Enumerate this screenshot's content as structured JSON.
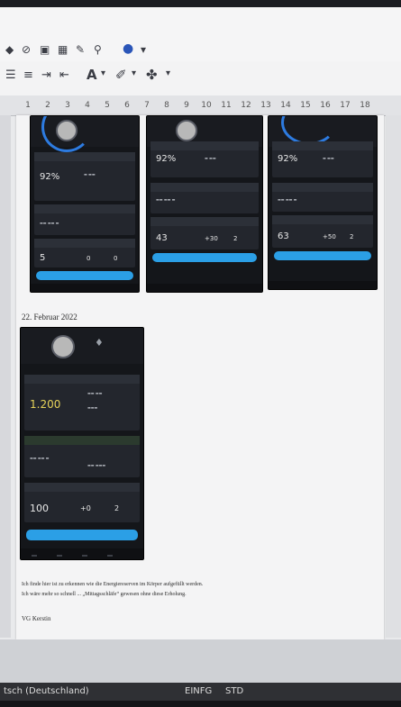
{
  "ruler": {
    "ticks": [
      "1",
      "2",
      "3",
      "4",
      "5",
      "6",
      "7",
      "8",
      "9",
      "10",
      "11",
      "12",
      "13",
      "14",
      "15",
      "16",
      "17",
      "18"
    ]
  },
  "toolbar": {
    "row1_icons": [
      "find-icon",
      "navigator-icon",
      "image-icon",
      "table-icon",
      "spellcheck-icon",
      "zoom-icon",
      "help-icon"
    ],
    "row2_icons": [
      "list-icon",
      "indent-icon",
      "outdent-icon",
      "font-color-icon",
      "highlight-icon",
      "character-icon"
    ]
  },
  "document": {
    "date_heading": "22. Februar 2022",
    "paragraph_line1": "Ich finde hier ist zu erkennen wie die Energiereserven im Körper aufgefüllt werden.",
    "paragraph_line2": "Ich wäre mehr so schnell ... „Mittagsschläfe“ gewesen ohne diese Erholung.",
    "signature": "VG Kerstin"
  },
  "phones": {
    "p1": {
      "value1": "92%",
      "value2": "5",
      "value3": "0",
      "value4": "0"
    },
    "p2": {
      "value1": "92%",
      "value2": "43",
      "value3": "+30",
      "value4": "2"
    },
    "p3": {
      "value1": "92%",
      "value2": "63",
      "value3": "+50",
      "value4": "2"
    },
    "p4": {
      "value1": "1.200",
      "value2": "100",
      "value3": "+0",
      "value4": "2"
    }
  },
  "status": {
    "language": "tsch (Deutschland)",
    "mode1": "EINFG",
    "mode2": "STD"
  }
}
